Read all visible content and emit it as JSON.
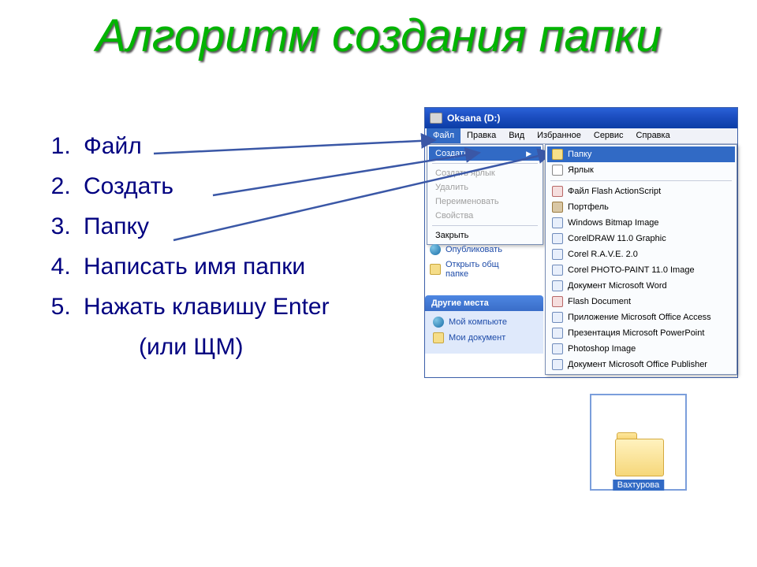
{
  "title": "Алгоритм создания папки",
  "steps": [
    "Файл",
    "Создать",
    "Папку",
    "Написать имя папки",
    "Нажать клавишу Enter"
  ],
  "step5_sub": "(или ЩМ)",
  "explorer": {
    "window_title": "Oksana (D:)",
    "menubar": [
      "Файл",
      "Правка",
      "Вид",
      "Избранное",
      "Сервис",
      "Справка"
    ],
    "file_menu": {
      "create": "Создать",
      "create_shortcut": "Создать ярлык",
      "delete": "Удалить",
      "rename": "Переименовать",
      "properties": "Свойства",
      "close": "Закрыть"
    },
    "create_submenu": [
      {
        "icon": "folder",
        "label": "Папку"
      },
      {
        "icon": "shortcut",
        "label": "Ярлык"
      },
      {
        "icon": "red",
        "label": "Файл Flash ActionScript"
      },
      {
        "icon": "briefcase",
        "label": "Портфель"
      },
      {
        "icon": "doc",
        "label": "Windows Bitmap Image"
      },
      {
        "icon": "doc",
        "label": "CorelDRAW 11.0 Graphic"
      },
      {
        "icon": "doc",
        "label": "Corel R.A.V.E. 2.0"
      },
      {
        "icon": "doc",
        "label": "Corel PHOTO-PAINT 11.0 Image"
      },
      {
        "icon": "doc",
        "label": "Документ Microsoft Word"
      },
      {
        "icon": "red",
        "label": "Flash Document"
      },
      {
        "icon": "doc",
        "label": "Приложение Microsoft Office Access"
      },
      {
        "icon": "doc",
        "label": "Презентация Microsoft PowerPoint"
      },
      {
        "icon": "doc",
        "label": "Photoshop Image"
      },
      {
        "icon": "doc",
        "label": "Документ Microsoft Office Publisher"
      }
    ],
    "tasks": {
      "publish": "Опубликовать",
      "open_shared": "Открыть общ",
      "open_shared2": "папке"
    },
    "places_header": "Другие места",
    "places": [
      "Мой компьюте",
      "Мои документ"
    ]
  },
  "folder_thumb_label": "Вахтурова",
  "colors": {
    "accent": "#316ac5",
    "title": "#00b400",
    "text_navy": "#000080"
  }
}
